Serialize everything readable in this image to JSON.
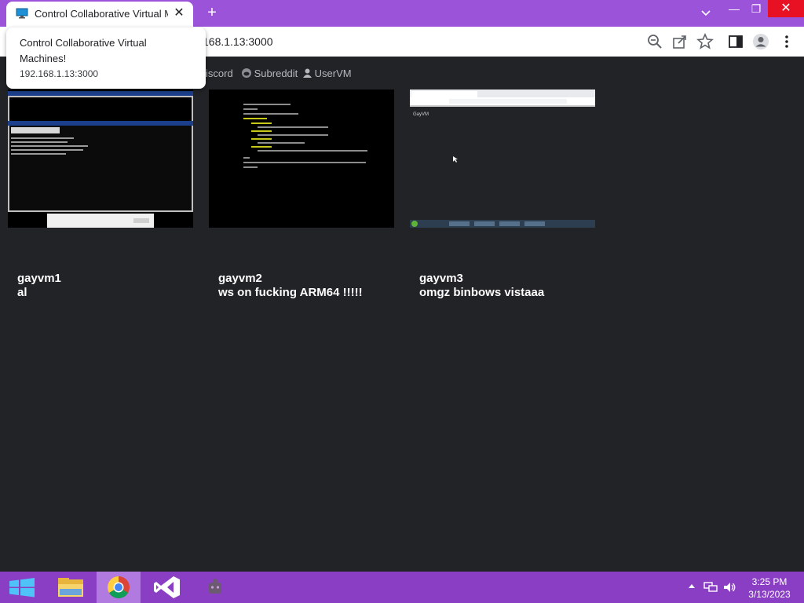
{
  "browser": {
    "tab_title": "Control Collaborative Virtual Machines!",
    "tab_close": "✕",
    "new_tab": "+",
    "url_visible": "168.1.13:3000",
    "window_minimize": "—",
    "window_restore": "❐",
    "window_close": "✕",
    "tab_search_icon": "chevron-down-icon"
  },
  "tooltip": {
    "title": "Control Collaborative Virtual Machines!",
    "url": "192.168.1.13:3000"
  },
  "nav": {
    "discord": "iscord",
    "subreddit": "Subreddit",
    "uservm": "UserVM"
  },
  "vms": [
    {
      "name": "gayvm1",
      "description": "al"
    },
    {
      "name": "gayvm2",
      "description": "ws on fucking ARM64 !!!!!"
    },
    {
      "name": "gayvm3",
      "description": "omgz binbows vistaaa"
    }
  ],
  "vm3_screen": {
    "title": "GayVM"
  },
  "taskbar": {
    "time": "3:25 PM",
    "date": "3/13/2023",
    "accent": "#8a3ec4"
  },
  "colors": {
    "tabstrip": "#9b53d9",
    "page_bg": "#212327"
  }
}
